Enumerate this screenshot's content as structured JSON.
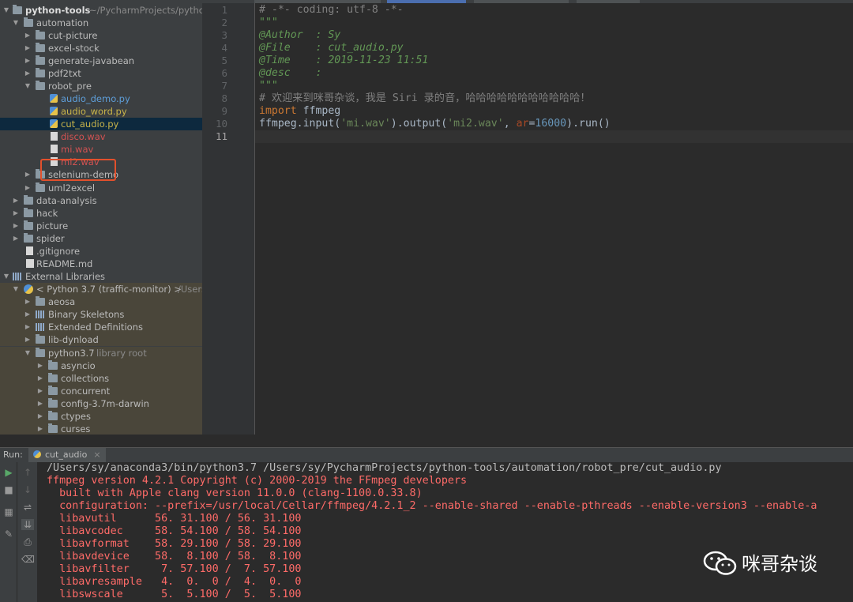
{
  "project_tree": {
    "rows": [
      {
        "label": "python-tools",
        "path": "~/PycharmProjects/python"
      },
      {
        "label": "automation"
      },
      {
        "label": "cut-picture"
      },
      {
        "label": "excel-stock"
      },
      {
        "label": "generate-javabean"
      },
      {
        "label": "pdf2txt"
      },
      {
        "label": "robot_pre"
      },
      {
        "label": "audio_demo.py"
      },
      {
        "label": "audio_word.py"
      },
      {
        "label": "cut_audio.py"
      },
      {
        "label": "disco.wav"
      },
      {
        "label": "mi.wav"
      },
      {
        "label": "mi2.wav"
      },
      {
        "label": "selenium-demo"
      },
      {
        "label": "uml2excel"
      },
      {
        "label": "data-analysis"
      },
      {
        "label": "hack"
      },
      {
        "label": "picture"
      },
      {
        "label": "spider"
      },
      {
        "label": ".gitignore"
      },
      {
        "label": "README.md"
      },
      {
        "label": "External Libraries"
      },
      {
        "label": "< Python 3.7 (traffic-monitor) >",
        "path": "/Users"
      },
      {
        "label": "aeosa"
      },
      {
        "label": "Binary Skeletons"
      },
      {
        "label": "Extended Definitions"
      },
      {
        "label": "lib-dynload"
      },
      {
        "label": "python3.7",
        "path": "library root"
      },
      {
        "label": "asyncio"
      },
      {
        "label": "collections"
      },
      {
        "label": "concurrent"
      },
      {
        "label": "config-3.7m-darwin"
      },
      {
        "label": "ctypes"
      },
      {
        "label": "curses"
      }
    ]
  },
  "editor": {
    "line_numbers": [
      "1",
      "2",
      "3",
      "4",
      "5",
      "6",
      "7",
      "8",
      "9",
      "10",
      "11"
    ],
    "lines": [
      [
        {
          "t": "# -*- coding: utf-8 -*-",
          "c": "k-cmt"
        }
      ],
      [
        {
          "t": "\"\"\"",
          "c": "k-doc"
        }
      ],
      [
        {
          "t": "@Author  : Sy",
          "c": "k-doc"
        }
      ],
      [
        {
          "t": "@File    : cut_audio.py",
          "c": "k-doc"
        }
      ],
      [
        {
          "t": "@Time    : 2019-11-23 11:51",
          "c": "k-doc"
        }
      ],
      [
        {
          "t": "@desc    :",
          "c": "k-doc"
        }
      ],
      [
        {
          "t": "\"\"\"",
          "c": "k-doc"
        }
      ],
      [
        {
          "t": "# 欢迎来到咪哥杂谈，我是 Siri 录的音，哈哈哈哈哈哈哈哈哈哈哈！",
          "c": "k-cmt"
        }
      ],
      [
        {
          "t": "import",
          "c": "k-kw"
        },
        {
          "t": " ffmpeg",
          "c": ""
        }
      ],
      [
        {
          "t": "ffmpeg.input(",
          "c": ""
        },
        {
          "t": "'mi.wav'",
          "c": "k-str"
        },
        {
          "t": ").output(",
          "c": ""
        },
        {
          "t": "'mi2.wav'",
          "c": "k-str"
        },
        {
          "t": ", ",
          "c": ""
        },
        {
          "t": "ar",
          "c": "k-par"
        },
        {
          "t": "=",
          "c": ""
        },
        {
          "t": "16000",
          "c": "k-num"
        },
        {
          "t": ").run()",
          "c": ""
        }
      ],
      [
        {
          "t": "",
          "c": ""
        }
      ]
    ]
  },
  "run_panel": {
    "label": "Run:",
    "tab": "cut_audio",
    "close": "×",
    "output": [
      {
        "t": "/Users/sy/anaconda3/bin/python3.7 /Users/sy/PycharmProjects/python-tools/automation/robot_pre/cut_audio.py",
        "c": "cmd"
      },
      {
        "t": "ffmpeg version 4.2.1 Copyright (c) 2000-2019 the FFmpeg developers",
        "c": "err"
      },
      {
        "t": "  built with Apple clang version 11.0.0 (clang-1100.0.33.8)",
        "c": "err"
      },
      {
        "t": "  configuration: --prefix=/usr/local/Cellar/ffmpeg/4.2.1_2 --enable-shared --enable-pthreads --enable-version3 --enable-a",
        "c": "err"
      },
      {
        "t": "  libavutil      56. 31.100 / 56. 31.100",
        "c": "err"
      },
      {
        "t": "  libavcodec     58. 54.100 / 58. 54.100",
        "c": "err"
      },
      {
        "t": "  libavformat    58. 29.100 / 58. 29.100",
        "c": "err"
      },
      {
        "t": "  libavdevice    58.  8.100 / 58.  8.100",
        "c": "err"
      },
      {
        "t": "  libavfilter     7. 57.100 /  7. 57.100",
        "c": "err"
      },
      {
        "t": "  libavresample   4.  0.  0 /  4.  0.  0",
        "c": "err"
      },
      {
        "t": "  libswscale      5.  5.100 /  5.  5.100",
        "c": "err"
      }
    ]
  },
  "watermark": {
    "text": "咪哥杂谈"
  },
  "colors": {
    "accent_box": "#e2502c",
    "selection": "#0d293e",
    "library_bg": "#4a463a",
    "console_error": "#ff6b68"
  }
}
